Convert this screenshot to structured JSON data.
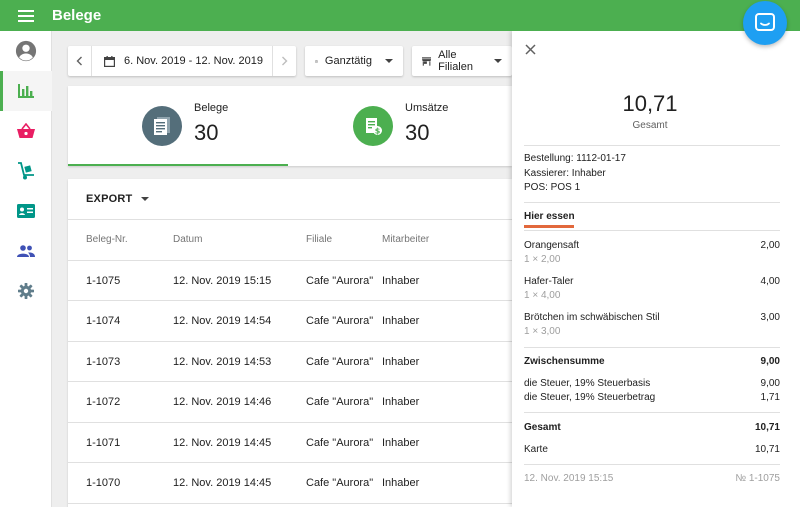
{
  "app": {
    "title": "Belege"
  },
  "filters": {
    "date_range": "6. Nov. 2019 - 12. Nov. 2019",
    "time": "Ganztätig",
    "branch": "Alle Filialen"
  },
  "summary": [
    {
      "label": "Belege",
      "value": "30"
    },
    {
      "label": "Umsätze",
      "value": "30"
    }
  ],
  "table": {
    "export_label": "EXPORT",
    "columns": [
      "Beleg-Nr.",
      "Datum",
      "Filiale",
      "Mitarbeiter"
    ],
    "rows": [
      [
        "1-1075",
        "12. Nov. 2019 15:15",
        "Cafe \"Aurora\"",
        "Inhaber"
      ],
      [
        "1-1074",
        "12. Nov. 2019 14:54",
        "Cafe \"Aurora\"",
        "Inhaber"
      ],
      [
        "1-1073",
        "12. Nov. 2019 14:53",
        "Cafe \"Aurora\"",
        "Inhaber"
      ],
      [
        "1-1072",
        "12. Nov. 2019 14:46",
        "Cafe \"Aurora\"",
        "Inhaber"
      ],
      [
        "1-1071",
        "12. Nov. 2019 14:45",
        "Cafe \"Aurora\"",
        "Inhaber"
      ],
      [
        "1-1070",
        "12. Nov. 2019 14:45",
        "Cafe \"Aurora\"",
        "Inhaber"
      ]
    ]
  },
  "detail": {
    "total": "10,71",
    "total_label": "Gesamt",
    "order": "Bestellung: 1112-01-17",
    "cashier": "Kassierer: Inhaber",
    "pos": "POS: POS 1",
    "dining_option": "Hier essen",
    "items": [
      {
        "name": "Orangensaft",
        "qty": "1 × 2,00",
        "amount": "2,00"
      },
      {
        "name": "Hafer-Taler",
        "qty": "1 × 4,00",
        "amount": "4,00"
      },
      {
        "name": "Brötchen im schwäbischen Stil",
        "qty": "1 × 3,00",
        "amount": "3,00"
      }
    ],
    "subtotal_label": "Zwischensumme",
    "subtotal": "9,00",
    "tax_base_label": "die Steuer, 19% Steuerbasis",
    "tax_base": "9,00",
    "tax_amount_label": "die Steuer, 19% Steuerbetrag",
    "tax_amount": "1,71",
    "grand_total_label": "Gesamt",
    "grand_total": "10,71",
    "payment_label": "Karte",
    "payment_amount": "10,71",
    "footer_date": "12. Nov. 2019 15:15",
    "footer_number": "№ 1-1075"
  },
  "colors": {
    "primary": "#4caf50",
    "accent_orange": "#e2683c",
    "receipts_icon_bg": "#546e7a",
    "chat_fab": "#1e9ff2",
    "nav_sales": "#4caf50",
    "nav_items": "#e91e63",
    "nav_inventory": "#009688",
    "nav_employees": "#009688",
    "nav_customers": "#3f51b5",
    "nav_settings": "#607d8b"
  },
  "icons": {
    "menu": "menu-icon",
    "account": "account-circle-icon",
    "reports": "bar-chart-icon",
    "items": "basket-icon",
    "inventory": "hand-truck-icon",
    "employees": "badge-card-icon",
    "customers": "people-icon",
    "settings": "gear-icon",
    "close": "close-icon",
    "chat": "chat-bubble-icon"
  }
}
